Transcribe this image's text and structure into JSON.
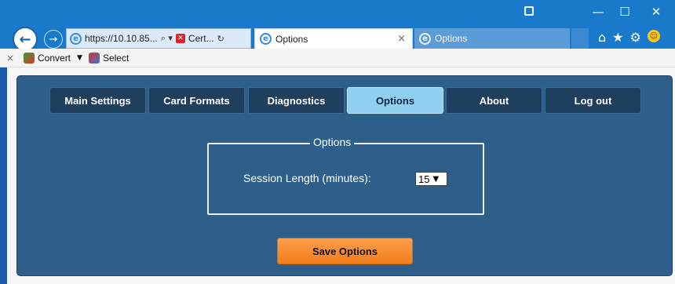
{
  "browser": {
    "address_url": "https://10.10.85...",
    "address_search_glyph": "⌕ ▾",
    "cert_label": "Cert...",
    "refresh_glyph": "↻",
    "tabs": [
      {
        "title": "Options",
        "close": "×"
      },
      {
        "title": "Options"
      }
    ],
    "window_controls": {
      "minimize": "—",
      "maximize": "☐",
      "close": "✕"
    },
    "toolbar_icons": {
      "home": "⌂",
      "star": "★",
      "gear": "⚙"
    },
    "command_bar": {
      "close": "×",
      "convert_label": "Convert",
      "convert_caret": "▼",
      "select_label": "Select"
    }
  },
  "app": {
    "nav": [
      {
        "label": "Main Settings"
      },
      {
        "label": "Card Formats"
      },
      {
        "label": "Diagnostics"
      },
      {
        "label": "Options",
        "active": true
      },
      {
        "label": "About"
      },
      {
        "label": "Log out"
      }
    ],
    "options_legend": "Options",
    "session_label": "Session Length (minutes):",
    "session_value": "15",
    "save_label": "Save Options"
  },
  "colors": {
    "titlebar": "#1979ca",
    "panel": "#2d5f8a",
    "nav_tab": "#1f3f5f",
    "nav_tab_active": "#8fcff0",
    "save_button": "#f58a2a"
  }
}
